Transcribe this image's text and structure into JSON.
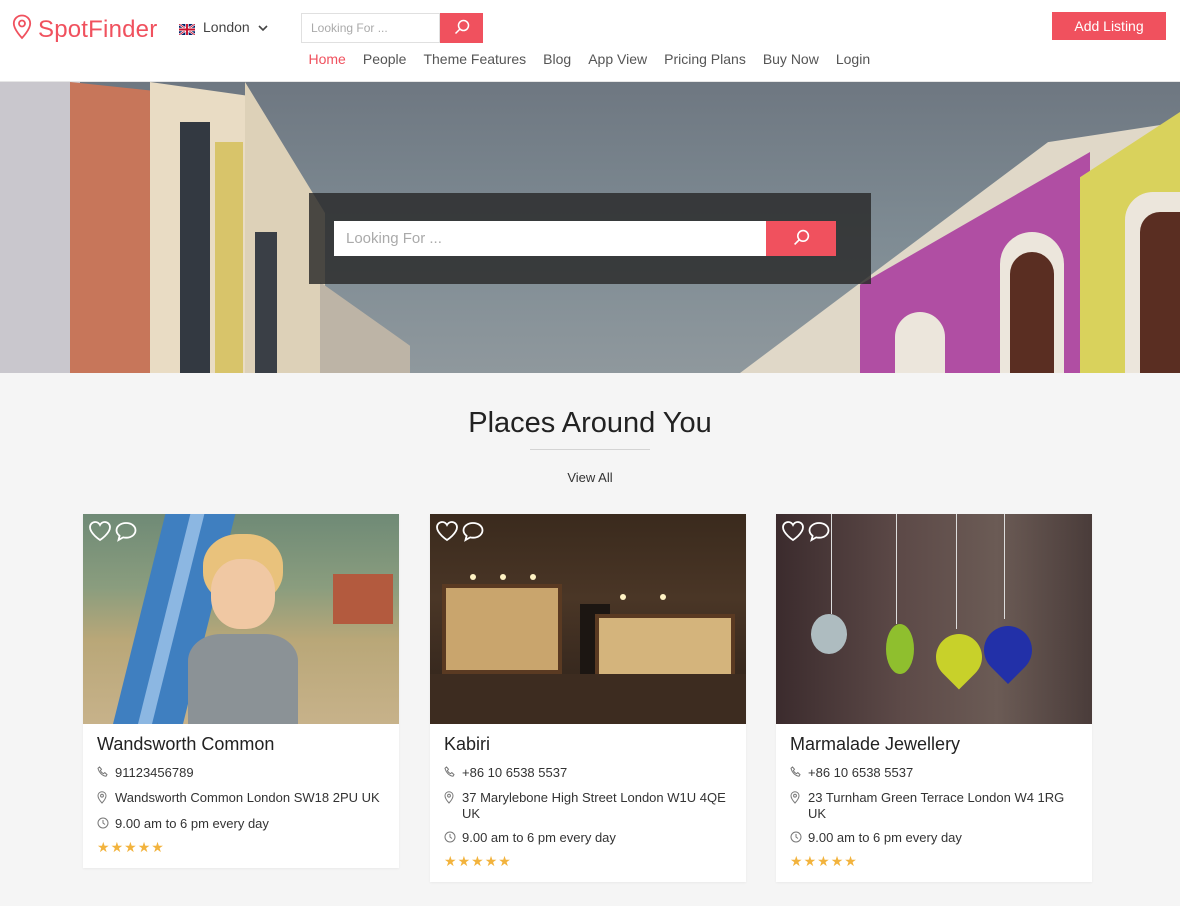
{
  "brand": {
    "name": "SpotFinder",
    "accent": "#f0515e"
  },
  "header": {
    "city": "London",
    "search_placeholder": "Looking For ...",
    "add_listing_label": "Add Listing"
  },
  "nav": {
    "items": [
      {
        "label": "Home",
        "active": true
      },
      {
        "label": "People"
      },
      {
        "label": "Theme Features"
      },
      {
        "label": "Blog"
      },
      {
        "label": "App View"
      },
      {
        "label": "Pricing Plans"
      },
      {
        "label": "Buy Now"
      },
      {
        "label": "Login"
      }
    ]
  },
  "hero": {
    "search_placeholder": "Looking For ..."
  },
  "section": {
    "title": "Places Around You",
    "view_all": "View All"
  },
  "listings": [
    {
      "title": "Wandsworth Common",
      "phone": "91123456789",
      "address": "Wandsworth Common London SW18 2PU UK",
      "hours": "9.00 am to 6 pm every day",
      "rating": 5
    },
    {
      "title": "Kabiri",
      "phone": "+86 10 6538 5537",
      "address": "37 Marylebone High Street London W1U 4QE UK",
      "hours": "9.00 am to 6 pm every day",
      "rating": 5
    },
    {
      "title": "Marmalade Jewellery",
      "phone": "+86 10 6538 5537",
      "address": "23 Turnham Green Terrace London W4 1RG UK",
      "hours": "9.00 am to 6 pm every day",
      "rating": 5
    }
  ],
  "icons": {
    "logo": "map-pin-icon",
    "search": "search-icon",
    "phone": "phone-icon",
    "location": "location-pin-icon",
    "hours": "clock-icon",
    "favorite": "heart-icon",
    "comment": "comment-icon",
    "rating": "star-icon"
  }
}
